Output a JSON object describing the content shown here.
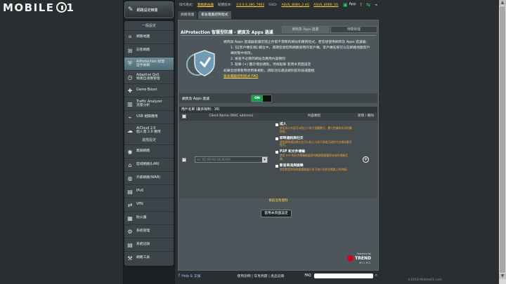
{
  "brand": {
    "logo_text": "MOBILE"
  },
  "quick_setup": {
    "label": "網路設定精靈"
  },
  "sidebar": {
    "general_title": "一般設定",
    "general": [
      {
        "label": "網路地圖",
        "icon": "network-map-icon"
      },
      {
        "label": "訪客網路",
        "icon": "guest-network-icon"
      },
      {
        "label": "AiProtection 智慧\n型手術網",
        "icon": "shield-icon",
        "active": true
      },
      {
        "label": "Adaptive QoS\n頻寬自適應管理",
        "icon": "qos-icon"
      },
      {
        "label": "Game Boost",
        "icon": "gamepad-icon"
      },
      {
        "label": "Traffic Analyzer\n流量分析",
        "icon": "chart-icon"
      },
      {
        "label": "USB 相關應用",
        "icon": "usb-icon"
      },
      {
        "label": "AiCloud 2.0\n個人雲 2.0 應用",
        "icon": "cloud-icon"
      }
    ],
    "advanced_title": "進階設定",
    "advanced": [
      {
        "label": "無線網路",
        "icon": "wifi-icon"
      },
      {
        "label": "區域網路(LAN)",
        "icon": "home-icon"
      },
      {
        "label": "外部網路(WAN)",
        "icon": "globe-icon"
      },
      {
        "label": "IPv6",
        "icon": "ipv6-icon"
      },
      {
        "label": "VPN",
        "icon": "vpn-icon"
      },
      {
        "label": "防火牆",
        "icon": "firewall-icon"
      },
      {
        "label": "系統管理",
        "icon": "admin-icon"
      },
      {
        "label": "系統記錄",
        "icon": "log-icon"
      },
      {
        "label": "網路工具",
        "icon": "tools-icon"
      }
    ]
  },
  "topbar": {
    "mode_label": "操作模式:",
    "mode_value": "無線路由器",
    "fw_label": "韌體版本:",
    "fw_value": "3.0.0.4.380_7983",
    "ssid_label": "SSID:",
    "ssid_1": "ASUS_80B0_2.4G",
    "ssid_2": "ASUS_80B0_5G",
    "app_label": "App"
  },
  "tabs": [
    "網路保護",
    "家長電腦控制程式"
  ],
  "page": {
    "title": "AiProtection 智慧型防護 - 網頁及 Apps 過濾",
    "subtabs": [
      "網頁及 Apps 過濾",
      "時間管理"
    ],
    "desc_intro": "網頁與 Apps 過濾器能讓您阻止存取不需要的網站和應用程式。若您想使用網頁及 Apps 過濾器：",
    "desc_steps": [
      "1. 在[客戶端名稱] 欄位中，選擇您想控制網路使用的客戶端。客戶端名稱可以在網路地圖客戶端狀態中修改。",
      "2. 檢查不必要的網站及應用內容類別",
      "3. 點擊 (+) 圖示增加規則，然後點擊 套用本頁面設定"
    ],
    "desc_note": "如果您想要暫時停用某規則，請取消勾選該規則前的核選圖框",
    "desc_link": "家長電腦控制程式 FAQ",
    "toggle_label": "網頁及 Apps 過濾",
    "toggle_state": "ON",
    "table_title": "用戶名單 (最多限制：16)",
    "col_client": "Client Name (MAC address)",
    "col_content": "內容類別",
    "col_add": "新增 / 刪除",
    "mac_placeholder": "ex: 0C:9D:92:26:80:B0",
    "categories": [
      {
        "title": "成人",
        "desc": "禁用成人內容可以防止小孩子接觸暴力、暴力色情和非法的藥物等。"
      },
      {
        "title": "即時通訊與社交",
        "desc": "禁用即時通訊與社交可以防止小孩子過度沉溺於社交網站應用程式。"
      },
      {
        "title": "P2P 和文件傳輸",
        "desc": "禁用 P2P 和文件傳輸能讓您的網路頻寬獲得有效的傳輸品質。"
      },
      {
        "title": "影音串流與娛樂",
        "desc": "禁用影音串流與娛樂能讓小孩子減少花費在網路上的時間。"
      }
    ],
    "no_data": "目前沒有資料",
    "apply": "套用本頁面設定",
    "trend": {
      "line1": "Powered by",
      "line2": "TREND",
      "line3": "MICRO"
    }
  },
  "footer": {
    "help": "Help & 支援",
    "links": "使用說明 | 常見問題 | 產品註冊",
    "faq": "FAQ"
  },
  "watermark": "©2018 Mobile01.com"
}
